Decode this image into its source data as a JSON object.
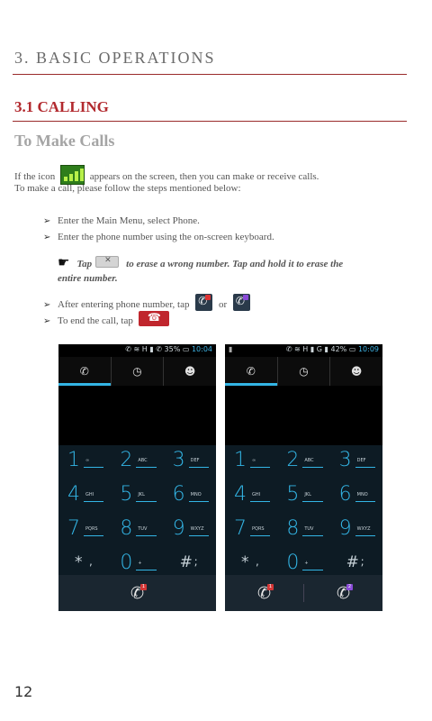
{
  "chapter": {
    "title": "3. BASIC OPERATIONS"
  },
  "section": {
    "title": "3.1 CALLING"
  },
  "subsection": {
    "title": "To Make Calls"
  },
  "intro": {
    "before_icon": "If the icon",
    "after_icon": "appears on the screen, then you can make or receive calls.",
    "line2": "To make a call, please follow the steps mentioned below:"
  },
  "steps": [
    {
      "text": "Enter the Main Menu, select Phone."
    },
    {
      "text": "Enter the phone number using the on-screen keyboard."
    }
  ],
  "note": {
    "tap": "Tap",
    "text": "to erase a wrong number. Tap and hold it to erase the",
    "line2": "entire number."
  },
  "steps_after": [
    {
      "text_before": "After entering phone number, tap",
      "or": "or"
    },
    {
      "text_before": "To end the call, tap"
    }
  ],
  "phones": [
    {
      "status": {
        "left": "",
        "right": "✆ ≋ H ▮ ✆ 35% ▭",
        "clock": "10:04"
      },
      "call_buttons": [
        {
          "badge": "1",
          "badge_color": "#d43636"
        }
      ]
    },
    {
      "status": {
        "left": "▮",
        "right": "✆ ≋ H ▮ G ▮ 42% ▭",
        "clock": "10:09"
      },
      "call_buttons": [
        {
          "badge": "1",
          "badge_color": "#d43636"
        },
        {
          "badge": "2",
          "badge_color": "#8a4bd8"
        }
      ]
    }
  ],
  "tabs": [
    {
      "icon": "phone-icon",
      "glyph": "✆"
    },
    {
      "icon": "clock-icon",
      "glyph": "◷"
    },
    {
      "icon": "contacts-icon",
      "glyph": "☻"
    }
  ],
  "keypad": [
    [
      {
        "digit": "1",
        "letters": "∞"
      },
      {
        "digit": "2",
        "letters": "ABC"
      },
      {
        "digit": "3",
        "letters": "DEF"
      }
    ],
    [
      {
        "digit": "4",
        "letters": "GHI"
      },
      {
        "digit": "5",
        "letters": "JKL"
      },
      {
        "digit": "6",
        "letters": "MNO"
      }
    ],
    [
      {
        "digit": "7",
        "letters": "PQRS"
      },
      {
        "digit": "8",
        "letters": "TUV"
      },
      {
        "digit": "9",
        "letters": "WXYZ"
      }
    ],
    [
      {
        "digit": "*",
        "letters": ","
      },
      {
        "digit": "0",
        "letters": "+"
      },
      {
        "digit": "#",
        "letters": ";"
      }
    ]
  ],
  "page_number": "12",
  "colors": {
    "accent_red": "#b2292e",
    "dialer_blue": "#33b5e5",
    "keypad_bg": "#0d1b24"
  }
}
